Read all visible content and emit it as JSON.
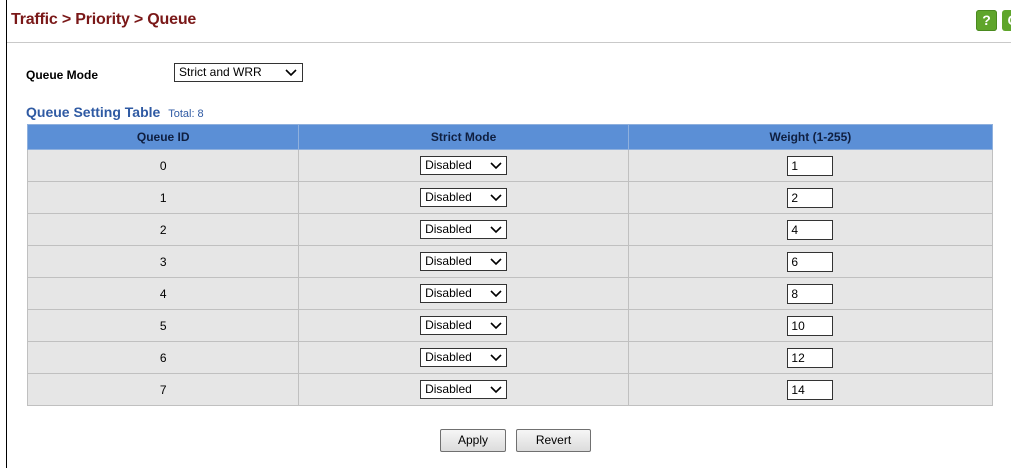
{
  "header": {
    "title": "Traffic > Priority > Queue",
    "help_icon": "?",
    "refresh_icon": "C"
  },
  "queue_mode": {
    "label": "Queue Mode",
    "value": "Strict and WRR"
  },
  "table": {
    "title": "Queue Setting Table",
    "total": "Total: 8",
    "columns": [
      "Queue ID",
      "Strict Mode",
      "Weight (1-255)"
    ],
    "rows": [
      {
        "id": "0",
        "strict": "Disabled",
        "weight": "1"
      },
      {
        "id": "1",
        "strict": "Disabled",
        "weight": "2"
      },
      {
        "id": "2",
        "strict": "Disabled",
        "weight": "4"
      },
      {
        "id": "3",
        "strict": "Disabled",
        "weight": "6"
      },
      {
        "id": "4",
        "strict": "Disabled",
        "weight": "8"
      },
      {
        "id": "5",
        "strict": "Disabled",
        "weight": "10"
      },
      {
        "id": "6",
        "strict": "Disabled",
        "weight": "12"
      },
      {
        "id": "7",
        "strict": "Disabled",
        "weight": "14"
      }
    ]
  },
  "buttons": {
    "apply": "Apply",
    "revert": "Revert"
  },
  "colors": {
    "title": "#7a1818",
    "table_header": "#5b8fd6",
    "table_title": "#2f5aa3",
    "row_bg": "#e6e6e6",
    "icon_green": "#5fa52b"
  }
}
